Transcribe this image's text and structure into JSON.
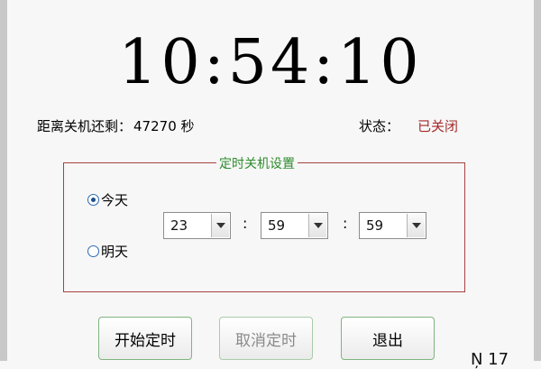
{
  "clock": {
    "time": "10:54:10"
  },
  "info": {
    "remain_label": "距离关机还剩：",
    "remain_value": "47270",
    "remain_unit": "秒",
    "status_label": "状态：",
    "status_value": "已关闭"
  },
  "settings": {
    "group_title": "定时关机设置",
    "today_label": "今天",
    "tomorrow_label": "明天",
    "today_selected": true,
    "hour": "23",
    "minute": "59",
    "second": "59",
    "separator": ":"
  },
  "buttons": {
    "start": "开始定时",
    "cancel": "取消定时",
    "exit": "退出"
  },
  "corner_text": "Ņ 17",
  "colors": {
    "status_off": "#a52a2a",
    "group_border": "#a8433f",
    "group_title": "#2e8b2e",
    "button_border": "#7fb47f"
  }
}
